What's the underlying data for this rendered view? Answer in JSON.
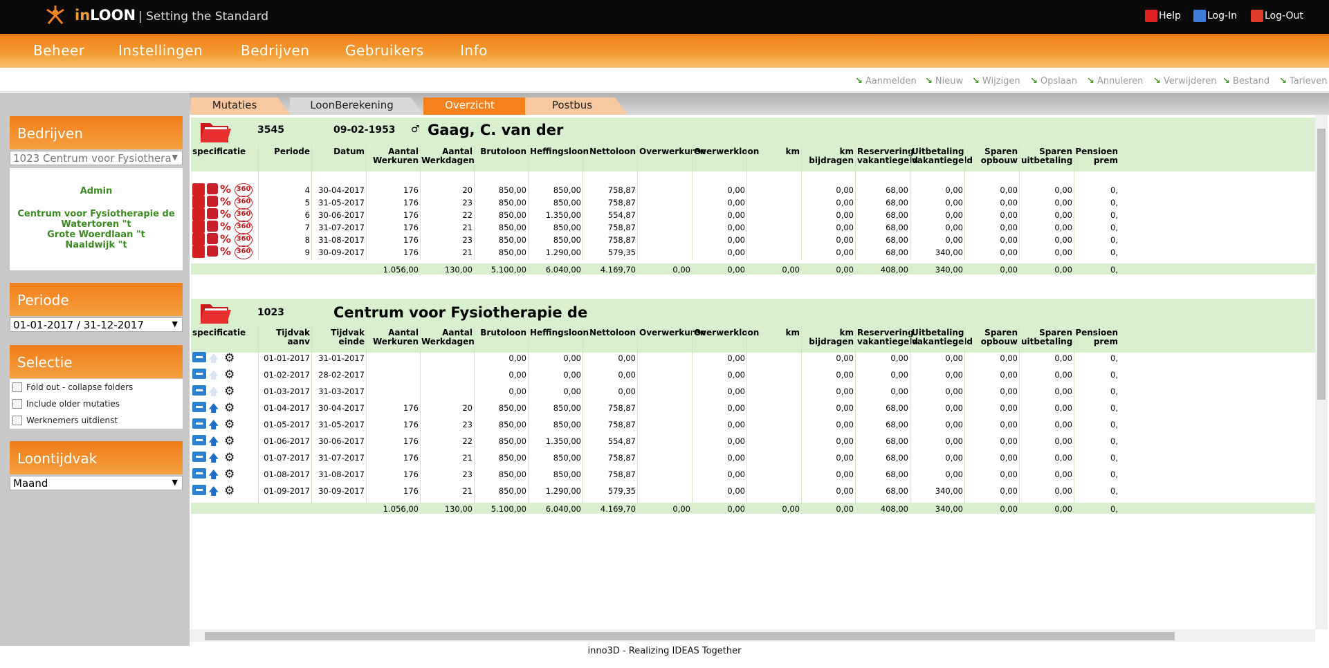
{
  "topbar": {
    "brand_in": "in",
    "brand_loon": "LOON",
    "tagline": "| Setting the Standard",
    "help": "Help",
    "login": "Log-In",
    "logout": "Log-Out"
  },
  "nav": [
    "Beheer",
    "Instellingen",
    "Bedrijven",
    "Gebruikers",
    "Info"
  ],
  "actions": [
    "Aanmelden",
    "Nieuw",
    "Wijzigen",
    "Opslaan",
    "Annuleren",
    "Verwijderen",
    "Bestand",
    "Tarieven"
  ],
  "left": {
    "bedrijven_title": "Bedrijven",
    "bedrijven_select": "1023 Centrum voor Fysiothera",
    "info_role": "Admin",
    "info_line1": "Centrum voor Fysiotherapie de",
    "info_line2": "Watertoren \"t",
    "info_line3": "Grote Woerdlaan \"t",
    "info_line4": "Naaldwijk \"t",
    "periode_title": "Periode",
    "periode_select": "01-01-2017 / 31-12-2017",
    "selectie_title": "Selectie",
    "selectie_opts": [
      "Fold out - collapse folders",
      "Include older mutaties",
      "Werknemers uitdienst"
    ],
    "loontijdvak_title": "Loontijdvak",
    "loontijdvak_select": "Maand"
  },
  "tabs": [
    "Mutaties",
    "LoonBerekening",
    "Overzicht",
    "Postbus"
  ],
  "section1": {
    "number": "3545",
    "date": "09-02-1953",
    "name": "Gaag, C. van der",
    "headers": [
      "specificatie",
      "Periode",
      "Datum",
      "Aantal Werkuren",
      "Aantal Werkdagen",
      "Brutoloon",
      "Heffingsloon",
      "Nettoloon",
      "Overwerkuren",
      "Overwerkloon",
      "km",
      "km bijdragen",
      "Reservering vakantiegeld",
      "Uitbetaling vakantiegeld",
      "Sparen opbouw",
      "Sparen uitbetaling",
      "Pensioen prem"
    ],
    "rows": [
      [
        "4",
        "30-04-2017",
        "176",
        "20",
        "850,00",
        "850,00",
        "758,87",
        "",
        "0,00",
        "",
        "0,00",
        "68,00",
        "0,00",
        "0,00",
        "0,00",
        "0,"
      ],
      [
        "5",
        "31-05-2017",
        "176",
        "23",
        "850,00",
        "850,00",
        "758,87",
        "",
        "0,00",
        "",
        "0,00",
        "68,00",
        "0,00",
        "0,00",
        "0,00",
        "0,"
      ],
      [
        "6",
        "30-06-2017",
        "176",
        "22",
        "850,00",
        "1.350,00",
        "554,87",
        "",
        "0,00",
        "",
        "0,00",
        "68,00",
        "0,00",
        "0,00",
        "0,00",
        "0,"
      ],
      [
        "7",
        "31-07-2017",
        "176",
        "21",
        "850,00",
        "850,00",
        "758,87",
        "",
        "0,00",
        "",
        "0,00",
        "68,00",
        "0,00",
        "0,00",
        "0,00",
        "0,"
      ],
      [
        "8",
        "31-08-2017",
        "176",
        "23",
        "850,00",
        "850,00",
        "758,87",
        "",
        "0,00",
        "",
        "0,00",
        "68,00",
        "0,00",
        "0,00",
        "0,00",
        "0,"
      ],
      [
        "9",
        "30-09-2017",
        "176",
        "21",
        "850,00",
        "1.290,00",
        "579,35",
        "",
        "0,00",
        "",
        "0,00",
        "68,00",
        "340,00",
        "0,00",
        "0,00",
        "0,"
      ]
    ],
    "totals": [
      "",
      "",
      "1.056,00",
      "130,00",
      "5.100,00",
      "6.040,00",
      "4.169,70",
      "0,00",
      "0,00",
      "0,00",
      "0,00",
      "408,00",
      "340,00",
      "0,00",
      "0,00",
      "0,"
    ]
  },
  "section2": {
    "number": "1023",
    "name": "Centrum voor Fysiotherapie de",
    "headers": [
      "specificatie",
      "Tijdvak aanv",
      "Tijdvak einde",
      "Aantal Werkuren",
      "Aantal Werkdagen",
      "Brutoloon",
      "Heffingsloon",
      "Nettoloon",
      "Overwerkuren",
      "Overwerkloon",
      "km",
      "km bijdragen",
      "Reservering vakantiegeld",
      "Uitbetaling vakantiegeld",
      "Sparen opbouw",
      "Sparen uitbetaling",
      "Pensioen prem"
    ],
    "rows": [
      [
        "01-01-2017",
        "31-01-2017",
        "",
        "",
        "0,00",
        "0,00",
        "0,00",
        "",
        "0,00",
        "",
        "0,00",
        "0,00",
        "0,00",
        "0,00",
        "0,00",
        "0,"
      ],
      [
        "01-02-2017",
        "28-02-2017",
        "",
        "",
        "0,00",
        "0,00",
        "0,00",
        "",
        "0,00",
        "",
        "0,00",
        "0,00",
        "0,00",
        "0,00",
        "0,00",
        "0,"
      ],
      [
        "01-03-2017",
        "31-03-2017",
        "",
        "",
        "0,00",
        "0,00",
        "0,00",
        "",
        "0,00",
        "",
        "0,00",
        "0,00",
        "0,00",
        "0,00",
        "0,00",
        "0,"
      ],
      [
        "01-04-2017",
        "30-04-2017",
        "176",
        "20",
        "850,00",
        "850,00",
        "758,87",
        "",
        "0,00",
        "",
        "0,00",
        "68,00",
        "0,00",
        "0,00",
        "0,00",
        "0,"
      ],
      [
        "01-05-2017",
        "31-05-2017",
        "176",
        "23",
        "850,00",
        "850,00",
        "758,87",
        "",
        "0,00",
        "",
        "0,00",
        "68,00",
        "0,00",
        "0,00",
        "0,00",
        "0,"
      ],
      [
        "01-06-2017",
        "30-06-2017",
        "176",
        "22",
        "850,00",
        "1.350,00",
        "554,87",
        "",
        "0,00",
        "",
        "0,00",
        "68,00",
        "0,00",
        "0,00",
        "0,00",
        "0,"
      ],
      [
        "01-07-2017",
        "31-07-2017",
        "176",
        "21",
        "850,00",
        "850,00",
        "758,87",
        "",
        "0,00",
        "",
        "0,00",
        "68,00",
        "0,00",
        "0,00",
        "0,00",
        "0,"
      ],
      [
        "01-08-2017",
        "31-08-2017",
        "176",
        "23",
        "850,00",
        "850,00",
        "758,87",
        "",
        "0,00",
        "",
        "0,00",
        "68,00",
        "0,00",
        "0,00",
        "0,00",
        "0,"
      ],
      [
        "01-09-2017",
        "30-09-2017",
        "176",
        "21",
        "850,00",
        "1.290,00",
        "579,35",
        "",
        "0,00",
        "",
        "0,00",
        "68,00",
        "340,00",
        "0,00",
        "0,00",
        "0,"
      ]
    ],
    "totals": [
      "",
      "",
      "1.056,00",
      "130,00",
      "5.100,00",
      "6.040,00",
      "4.169,70",
      "0,00",
      "0,00",
      "0,00",
      "0,00",
      "408,00",
      "340,00",
      "0,00",
      "0,00",
      "0,"
    ]
  },
  "footer": "inno3D - Realizing IDEAS Together",
  "colors": {
    "orange": "#f07d18",
    "green_row": "#d8f0cf",
    "nav_text": "#ffffff"
  }
}
